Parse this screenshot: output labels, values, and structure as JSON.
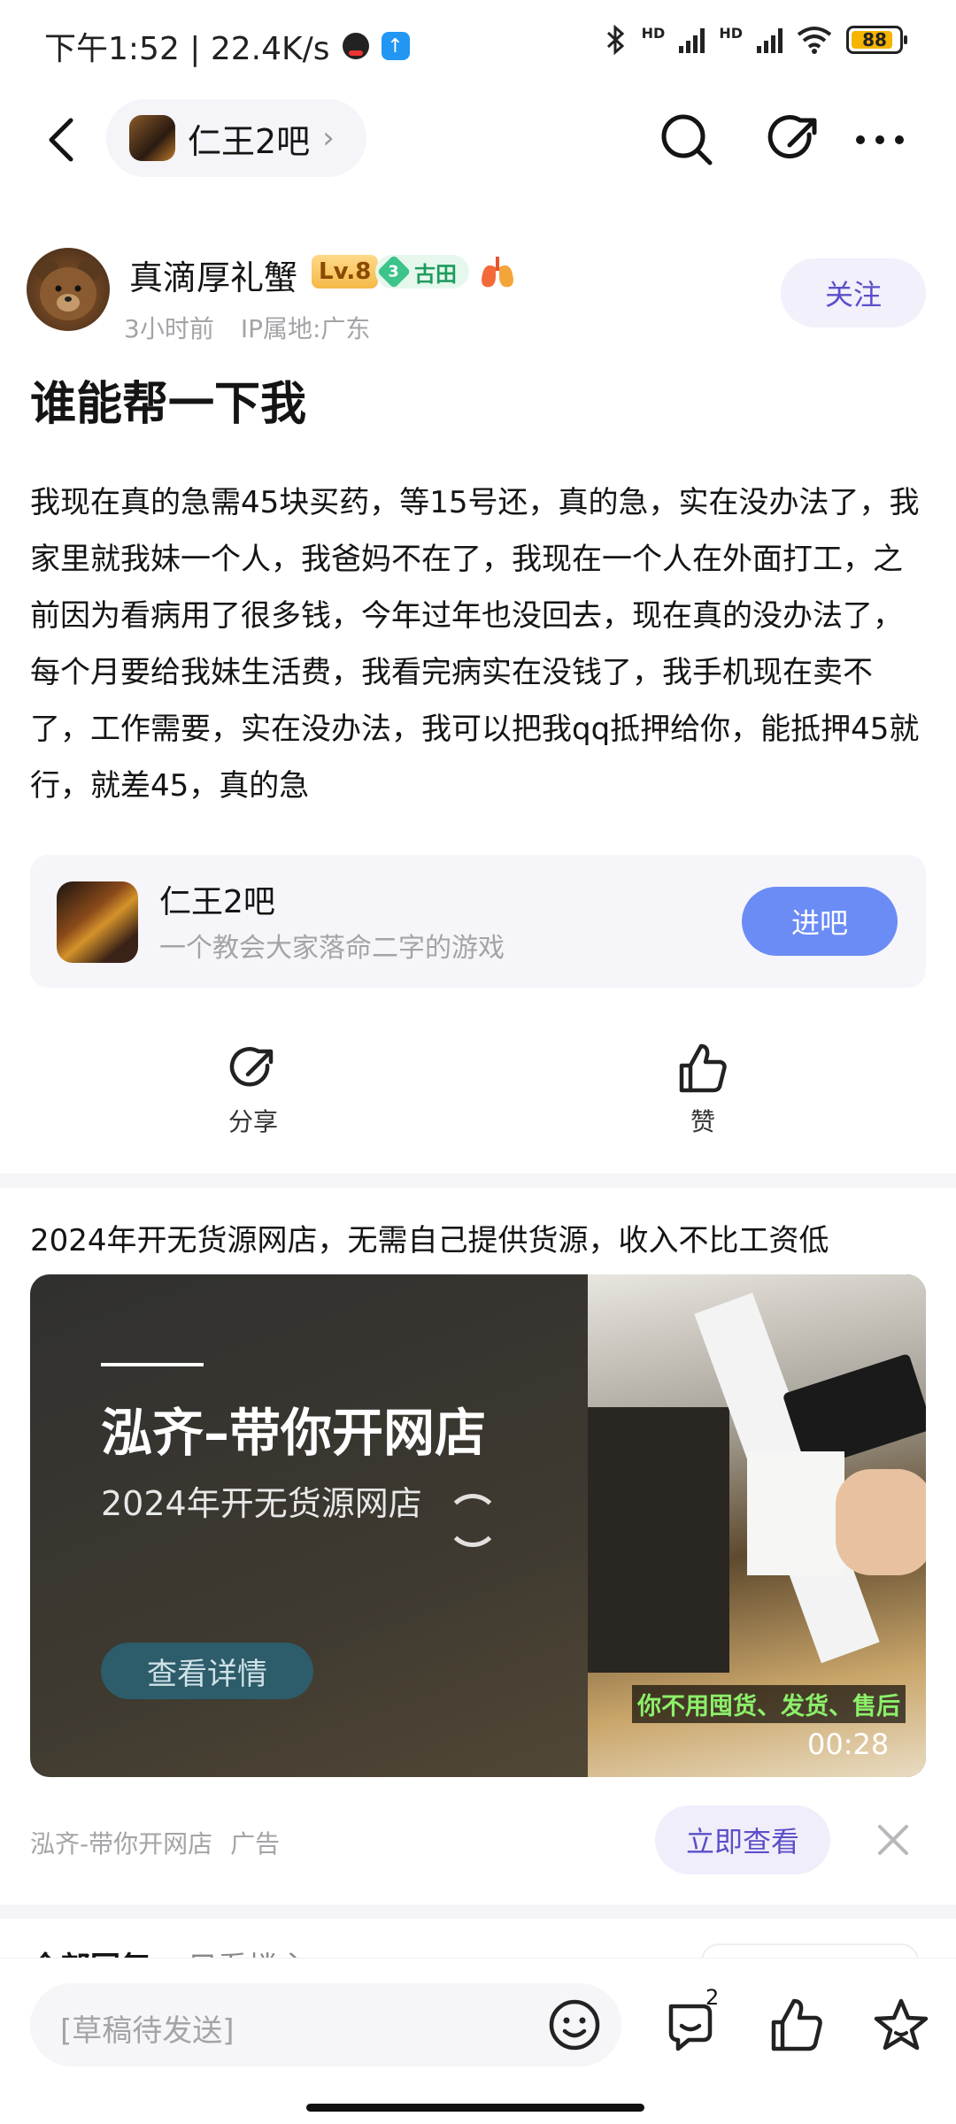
{
  "status_bar": {
    "time_speed": "下午1:52 | 22.4K/s",
    "upload_icon": "↑",
    "hd1": "HD",
    "hd2": "HD",
    "battery": "88",
    "battery_level": 0.88,
    "battery_color": "#f5b400"
  },
  "nav": {
    "forum_chip_label": "仁王2吧",
    "chip_arrow": "›",
    "icons": [
      "back-icon",
      "search-icon",
      "share-icon",
      "more-icon"
    ]
  },
  "author": {
    "name": "真滴厚礼蟹",
    "level": "Lv.8",
    "title_badge_number": "3",
    "title_badge_text": "古田",
    "time": "3小时前",
    "ip": "IP属地:广东",
    "follow_label": "关注"
  },
  "post": {
    "title": "谁能帮一下我",
    "body": "我现在真的急需45块买药，等15号还，真的急，实在没办法了，我家里就我妹一个人，我爸妈不在了，我现在一个人在外面打工，之前因为看病用了很多钱，今年过年也没回去，现在真的没办法了，每个月要给我妹生活费，我看完病实在没钱了，我手机现在卖不了，工作需要，实在没办法，我可以把我qq抵押给你，能抵押45就行，就差45，真的急"
  },
  "forum_card": {
    "name": "仁王2吧",
    "description": "一个教会大家落命二字的游戏",
    "enter_label": "进吧"
  },
  "actions": {
    "share_label": "分享",
    "like_label": "赞"
  },
  "ad": {
    "headline": "2024年开无货源网店，无需自己提供货源，收入不比工资低",
    "big_text": "泓齐–带你开网店",
    "sub_text": "2024年开无货源网店",
    "detail_label": "查看详情",
    "caption": "你不用囤货、发货、售后",
    "duration": "00:28",
    "source": "泓齐-带你开网店",
    "ad_tag": "广告",
    "view_label": "立即查看"
  },
  "peek": {
    "section_title": "全部回复",
    "sort": "只看楼主"
  },
  "bottom_bar": {
    "reply_placeholder": "[草稿待发送]",
    "comment_count": "2"
  },
  "colors": {
    "accent": "#5b4fc9",
    "enter_button": "#6b8cf5",
    "level_badge": "#f5b947",
    "title_badge": "#3cc48a"
  }
}
